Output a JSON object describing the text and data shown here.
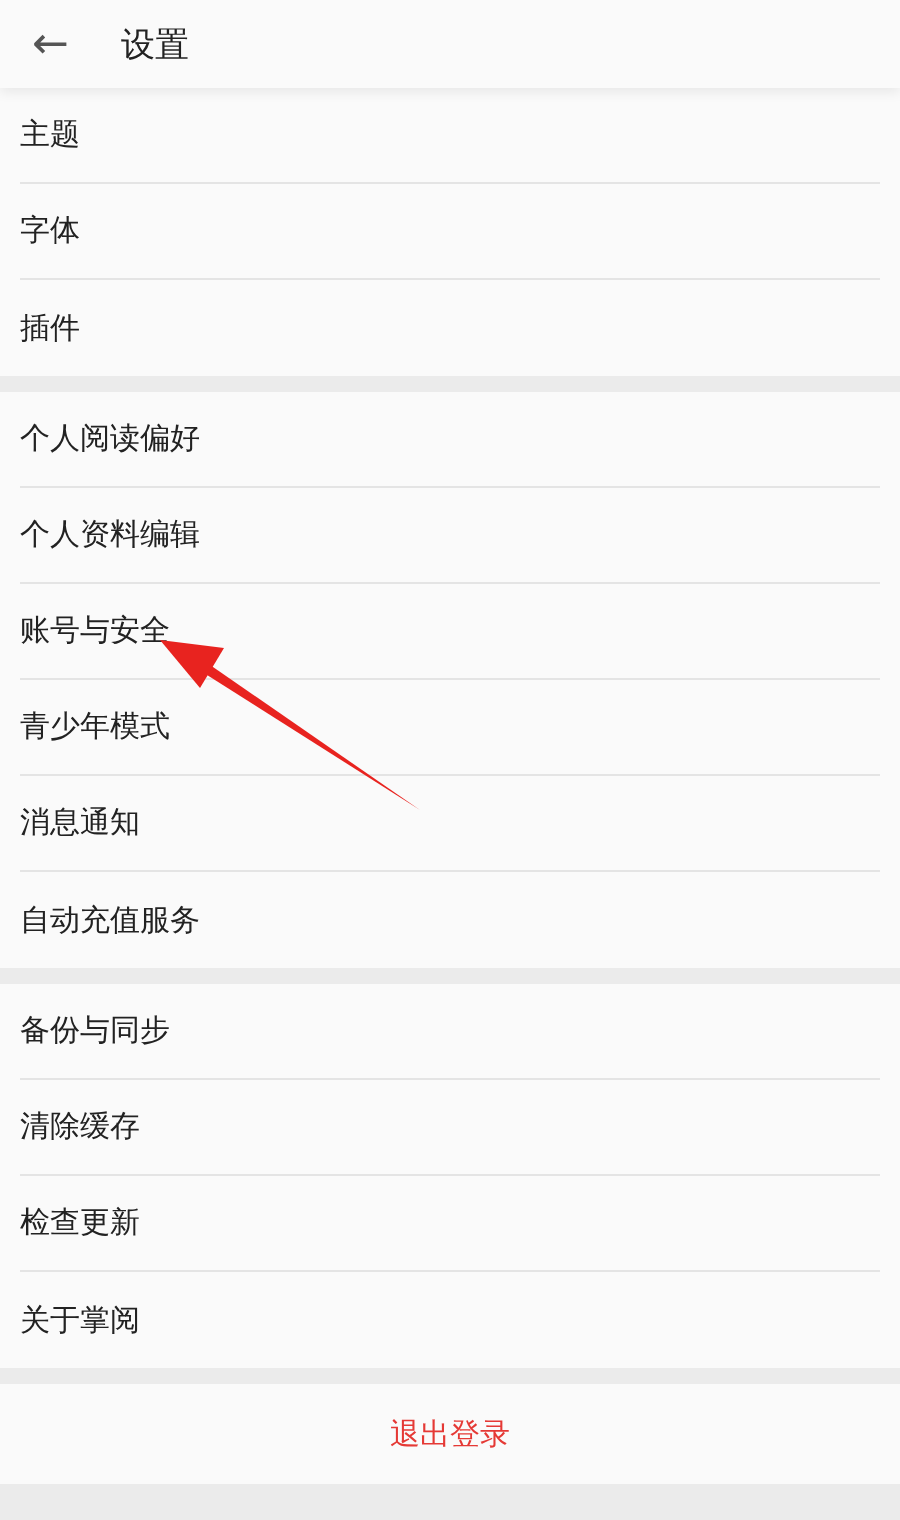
{
  "header": {
    "back_icon": "←",
    "title": "设置"
  },
  "sections": [
    {
      "items": [
        "主题",
        "字体",
        "插件"
      ]
    },
    {
      "items": [
        "个人阅读偏好",
        "个人资料编辑",
        "账号与安全",
        "青少年模式",
        "消息通知",
        "自动充值服务"
      ]
    },
    {
      "items": [
        "备份与同步",
        "清除缓存",
        "检查更新",
        "关于掌阅"
      ]
    }
  ],
  "logout_button": "退出登录"
}
